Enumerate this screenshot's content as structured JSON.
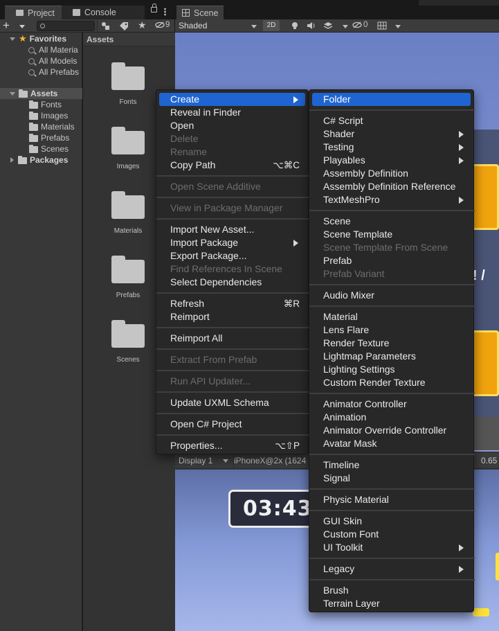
{
  "tabs": {
    "project": "Project",
    "console": "Console",
    "scene": "Scene"
  },
  "project_toolbar": {
    "add_label": "+",
    "search_value": "",
    "hidden_count": "9"
  },
  "tree": {
    "favorites": {
      "label": "Favorites",
      "items": [
        "All Materia",
        "All Models",
        "All Prefabs"
      ]
    },
    "assets": {
      "label": "Assets",
      "items": [
        "Fonts",
        "Images",
        "Materials",
        "Prefabs",
        "Scenes"
      ]
    },
    "packages": "Packages"
  },
  "assets_panel": {
    "header": "Assets",
    "folders": [
      "Fonts",
      "Images",
      "Materials",
      "Prefabs",
      "Scenes"
    ]
  },
  "scene_toolbar": {
    "shading": "Shaded",
    "mode_2d": "2D",
    "hidden_count": "0"
  },
  "game_bar": {
    "display": "Display 1",
    "resolution": "iPhoneX@2x (1624",
    "scale": "0.65"
  },
  "game": {
    "timer": "03:43",
    "overlay_text": "! /"
  },
  "context_menu": {
    "items": [
      {
        "label": "Create",
        "submenu": true,
        "highlighted": true
      },
      {
        "label": "Reveal in Finder"
      },
      {
        "label": "Open"
      },
      {
        "label": "Delete",
        "disabled": true
      },
      {
        "label": "Rename",
        "disabled": true
      },
      {
        "label": "Copy Path",
        "shortcut": "⌥⌘C"
      },
      {
        "label": "Open Scene Additive",
        "disabled": true
      },
      {
        "label": "View in Package Manager",
        "disabled": true
      },
      {
        "label": "Import New Asset..."
      },
      {
        "label": "Import Package",
        "submenu": true
      },
      {
        "label": "Export Package..."
      },
      {
        "label": "Find References In Scene",
        "disabled": true
      },
      {
        "label": "Select Dependencies"
      },
      {
        "label": "Refresh",
        "shortcut": "⌘R"
      },
      {
        "label": "Reimport"
      },
      {
        "label": "Reimport All"
      },
      {
        "label": "Extract From Prefab",
        "disabled": true
      },
      {
        "label": "Run API Updater...",
        "disabled": true
      },
      {
        "label": "Update UXML Schema"
      },
      {
        "label": "Open C# Project"
      },
      {
        "label": "Properties...",
        "shortcut": "⌥⇧P"
      }
    ]
  },
  "create_submenu": {
    "items": [
      {
        "label": "Folder",
        "highlighted": true
      },
      {
        "label": "C# Script"
      },
      {
        "label": "Shader",
        "submenu": true
      },
      {
        "label": "Testing",
        "submenu": true
      },
      {
        "label": "Playables",
        "submenu": true
      },
      {
        "label": "Assembly Definition"
      },
      {
        "label": "Assembly Definition Reference"
      },
      {
        "label": "TextMeshPro",
        "submenu": true
      },
      {
        "label": "Scene"
      },
      {
        "label": "Scene Template"
      },
      {
        "label": "Scene Template From Scene",
        "disabled": true
      },
      {
        "label": "Prefab"
      },
      {
        "label": "Prefab Variant",
        "disabled": true
      },
      {
        "label": "Audio Mixer"
      },
      {
        "label": "Material"
      },
      {
        "label": "Lens Flare"
      },
      {
        "label": "Render Texture"
      },
      {
        "label": "Lightmap Parameters"
      },
      {
        "label": "Lighting Settings"
      },
      {
        "label": "Custom Render Texture"
      },
      {
        "label": "Animator Controller"
      },
      {
        "label": "Animation"
      },
      {
        "label": "Animator Override Controller"
      },
      {
        "label": "Avatar Mask"
      },
      {
        "label": "Timeline"
      },
      {
        "label": "Signal"
      },
      {
        "label": "Physic Material"
      },
      {
        "label": "GUI Skin"
      },
      {
        "label": "Custom Font"
      },
      {
        "label": "UI Toolkit",
        "submenu": true
      },
      {
        "label": "Legacy",
        "submenu": true
      },
      {
        "label": "Brush"
      },
      {
        "label": "Terrain Layer"
      }
    ]
  },
  "colors": {
    "highlight": "#1f64d0",
    "menu_bg": "#282828",
    "favorite_star": "#f3b634"
  }
}
